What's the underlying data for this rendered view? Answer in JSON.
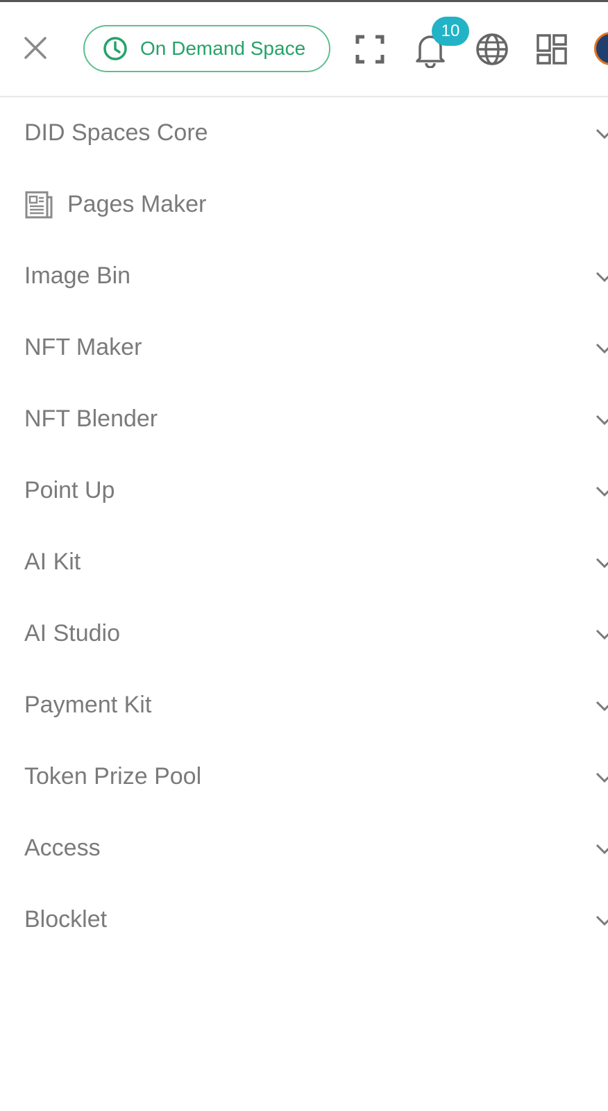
{
  "header": {
    "close_icon": "close-icon",
    "ondemand_label": "On Demand Space",
    "ondemand_icon": "clock-icon",
    "fullscreen_icon": "fullscreen-icon",
    "notification_icon": "bell-icon",
    "notification_count": "10",
    "language_icon": "globe-icon",
    "apps_icon": "apps-grid-icon",
    "avatar_icon": "avatar"
  },
  "colors": {
    "accent_green": "#26a269",
    "badge": "#22b3c6",
    "menu_text": "#7a7a7a"
  },
  "menu": {
    "items": [
      {
        "label": "DID Spaces Core",
        "expandable": true
      },
      {
        "label": "Pages Maker",
        "expandable": false,
        "icon": "document-icon"
      },
      {
        "label": "Image Bin",
        "expandable": true
      },
      {
        "label": "NFT Maker",
        "expandable": true
      },
      {
        "label": "NFT Blender",
        "expandable": true
      },
      {
        "label": "Point Up",
        "expandable": true
      },
      {
        "label": "AI Kit",
        "expandable": true
      },
      {
        "label": "AI Studio",
        "expandable": true
      },
      {
        "label": "Payment Kit",
        "expandable": true
      },
      {
        "label": "Token Prize Pool",
        "expandable": true
      },
      {
        "label": "Access",
        "expandable": true
      },
      {
        "label": "Blocklet",
        "expandable": true
      }
    ]
  }
}
